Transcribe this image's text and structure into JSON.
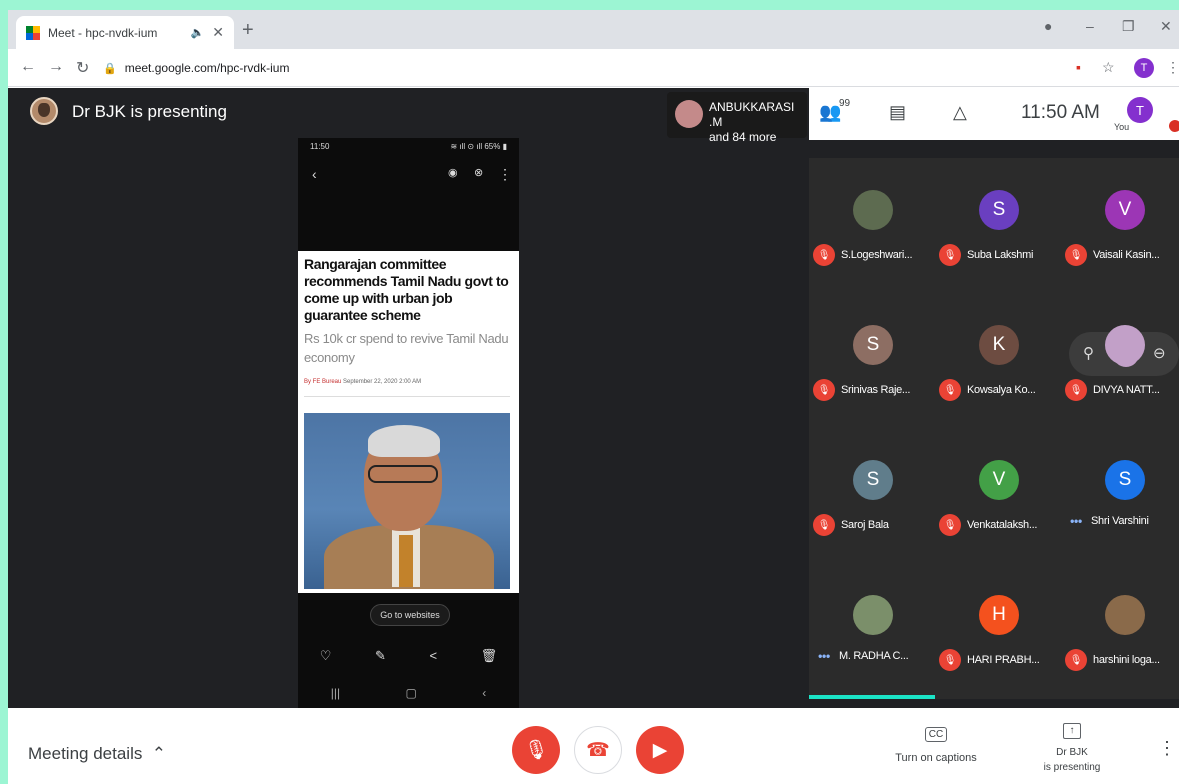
{
  "browser": {
    "tab_title": "Meet - hpc-nvdk-ium",
    "tab_speaker": "🔈",
    "tab_close": "✕",
    "new_tab": "+",
    "url": "meet.google.com/hpc-rvdk-ium",
    "profile_initial": "T"
  },
  "meet": {
    "presenting_label": "Dr BJK is presenting",
    "attendee_summary_name": "ANBUKKARASI .M",
    "attendee_summary_more": "and 84 more",
    "participant_count": "99",
    "clock": "11:50 AM",
    "you_initial": "T",
    "you_label": "You"
  },
  "phone": {
    "status_time": "11:50",
    "status_right": "≋ ıll ⊙ ıll 65% ▮",
    "headline": "Rangarajan committee recommends Tamil Nadu govt to come up with urban job guarantee scheme",
    "subhead": "Rs 10k cr spend to revive Tamil Nadu economy",
    "byline_author": "By FE Bureau",
    "byline_date": "September 22, 2020 2:00 AM",
    "goto_button": "Go to websites"
  },
  "participants": [
    {
      "name": "S.Logeshwari...",
      "initial": "",
      "color": "#5d6b50",
      "status": "muted"
    },
    {
      "name": "Suba Lakshmi",
      "initial": "S",
      "color": "#6a3fc0",
      "status": "muted"
    },
    {
      "name": "Vaisali Kasin...",
      "initial": "V",
      "color": "#9c36b5",
      "status": "muted"
    },
    {
      "name": "Srinivas Raje...",
      "initial": "S",
      "color": "#8d6e63",
      "status": "muted"
    },
    {
      "name": "Kowsalya Ko...",
      "initial": "K",
      "color": "#6d4c41",
      "status": "muted"
    },
    {
      "name": "DIVYA NATT...",
      "initial": "",
      "color": "#c2a0c8",
      "status": "muted"
    },
    {
      "name": "Saroj Bala",
      "initial": "S",
      "color": "#607d8b",
      "status": "muted"
    },
    {
      "name": "Venkatalaksh...",
      "initial": "V",
      "color": "#43a047",
      "status": "muted"
    },
    {
      "name": "Shri Varshini",
      "initial": "S",
      "color": "#1a73e8",
      "status": "speaking"
    },
    {
      "name": "M. RADHA C...",
      "initial": "",
      "color": "#7b8f6a",
      "status": "speaking"
    },
    {
      "name": "HARI PRABH...",
      "initial": "H",
      "color": "#f4511e",
      "status": "muted"
    },
    {
      "name": "harshini loga...",
      "initial": "",
      "color": "#8a6a4a",
      "status": "muted"
    }
  ],
  "bottom": {
    "meeting_details": "Meeting details",
    "captions_icon": "CC",
    "captions_label": "Turn on captions",
    "present_line1": "Dr BJK",
    "present_line2": "is presenting"
  },
  "colors": {
    "end_call_red": "#ea4335",
    "meet_background": "#202124",
    "outer_border": "#9cf5d3"
  }
}
